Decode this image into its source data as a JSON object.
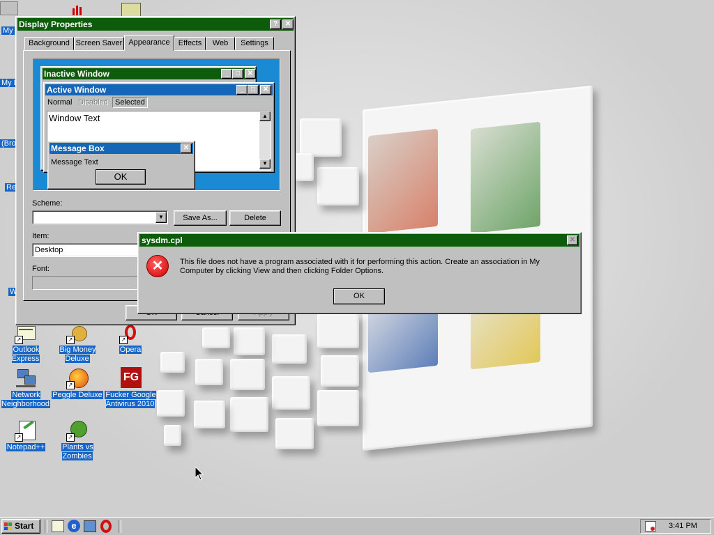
{
  "desktop_icons": [
    {
      "label": "Outlook Express",
      "icon": "outlook-express-icon"
    },
    {
      "label": "Big Money Deluxe",
      "icon": "big-money-icon"
    },
    {
      "label": "Opera",
      "icon": "opera-icon"
    },
    {
      "label": "Network Neighborhood",
      "icon": "network-icon"
    },
    {
      "label": "Peggle Deluxe",
      "icon": "peggle-icon"
    },
    {
      "label": "Fucker Google Antivirus 2010",
      "icon": "antivirus-icon"
    },
    {
      "label": "Notepad++",
      "icon": "notepad-icon"
    },
    {
      "label": "Plants vs Zombies",
      "icon": "pvz-icon"
    }
  ],
  "left_edge_labels": [
    "My",
    "My D",
    "(Bro",
    "Re",
    "W"
  ],
  "antivirus_glyph": "FG",
  "display_properties": {
    "title": "Display Properties",
    "help_btn": "?",
    "close_btn": "✕",
    "tabs": [
      "Background",
      "Screen Saver",
      "Appearance",
      "Effects",
      "Web",
      "Settings"
    ],
    "active_tab": "Appearance",
    "preview": {
      "inactive_title": "Inactive Window",
      "active_title": "Active Window",
      "menu_normal": "Normal",
      "menu_disabled": "Disabled",
      "menu_selected": "Selected",
      "window_text": "Window Text",
      "msgbox_title": "Message Box",
      "msgbox_text": "Message Text",
      "msgbox_ok": "OK"
    },
    "scheme_label": "Scheme:",
    "scheme_value": "",
    "save_as": "Save As...",
    "delete": "Delete",
    "item_label": "Item:",
    "item_value": "Desktop",
    "font_label": "Font:",
    "bottom_buttons": [
      "OK",
      "Cancel",
      "Apply"
    ]
  },
  "dialog": {
    "title": "sysdm.cpl",
    "close_btn": "✕",
    "message": "This file does not have a program associated with it for performing this action. Create an association in My Computer by clicking View and then clicking Folder Options.",
    "ok": "OK",
    "icon": "error-icon"
  },
  "taskbar": {
    "start": "Start",
    "quick_launch": [
      "outlook-express-icon",
      "internet-explorer-icon",
      "show-desktop-icon",
      "opera-icon"
    ],
    "time": "3:41 PM"
  },
  "colors": {
    "desktop_label_bg": "#1566c8",
    "active_title": "#0a246a",
    "green_title": "#0c5c0c",
    "face": "#c0c0c0"
  }
}
